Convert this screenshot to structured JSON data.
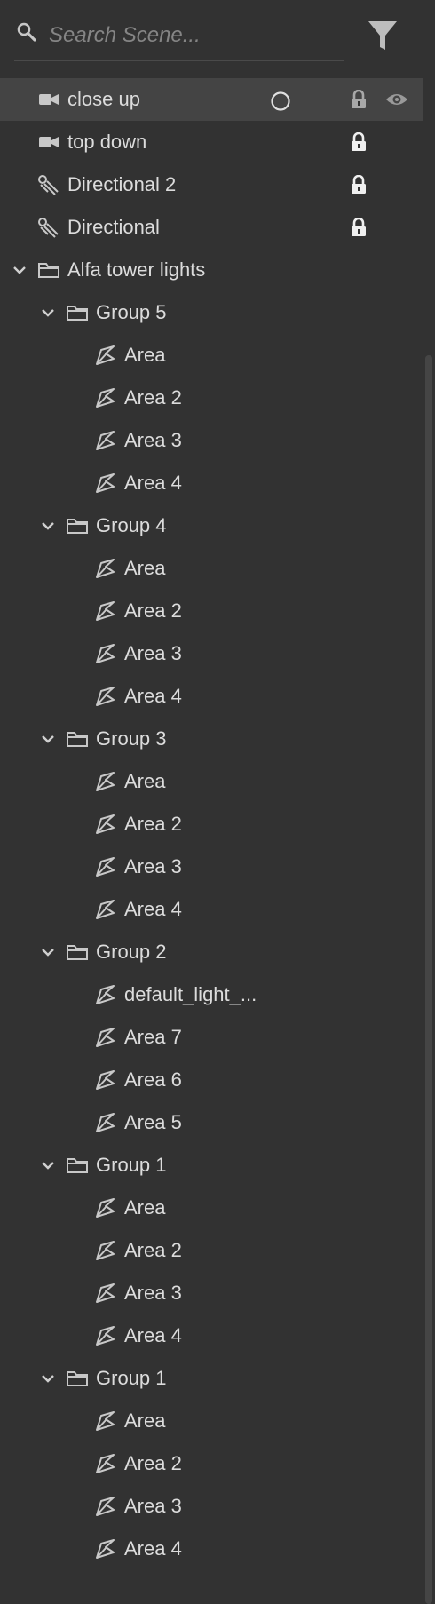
{
  "search": {
    "placeholder": "Search Scene..."
  },
  "icons": {
    "search": "search-icon",
    "filter": "filter-icon"
  },
  "colors": {
    "background": "#323232",
    "selected_row": "#444444",
    "text": "#dcdcdc"
  },
  "tree": {
    "items": [
      {
        "label": "close up",
        "type": "camera",
        "depth": 0,
        "selected": true,
        "locked": true,
        "visible": true,
        "circle": true
      },
      {
        "label": "top down",
        "type": "camera",
        "depth": 0,
        "locked": true
      },
      {
        "label": "Directional 2",
        "type": "directional",
        "depth": 0,
        "locked": true
      },
      {
        "label": "Directional",
        "type": "directional",
        "depth": 0,
        "locked": true
      },
      {
        "label": "Alfa tower lights",
        "type": "folder",
        "depth": 0,
        "expanded": true
      },
      {
        "label": "Group 5",
        "type": "folder",
        "depth": 1,
        "expanded": true
      },
      {
        "label": "Area",
        "type": "area",
        "depth": 2
      },
      {
        "label": "Area 2",
        "type": "area",
        "depth": 2
      },
      {
        "label": "Area 3",
        "type": "area",
        "depth": 2
      },
      {
        "label": "Area 4",
        "type": "area",
        "depth": 2
      },
      {
        "label": "Group 4",
        "type": "folder",
        "depth": 1,
        "expanded": true
      },
      {
        "label": "Area",
        "type": "area",
        "depth": 2
      },
      {
        "label": "Area 2",
        "type": "area",
        "depth": 2
      },
      {
        "label": "Area 3",
        "type": "area",
        "depth": 2
      },
      {
        "label": "Area 4",
        "type": "area",
        "depth": 2
      },
      {
        "label": "Group 3",
        "type": "folder",
        "depth": 1,
        "expanded": true
      },
      {
        "label": "Area",
        "type": "area",
        "depth": 2
      },
      {
        "label": "Area 2",
        "type": "area",
        "depth": 2
      },
      {
        "label": "Area 3",
        "type": "area",
        "depth": 2
      },
      {
        "label": "Area 4",
        "type": "area",
        "depth": 2
      },
      {
        "label": "Group 2",
        "type": "folder",
        "depth": 1,
        "expanded": true
      },
      {
        "label": "default_light_...",
        "type": "area",
        "depth": 2
      },
      {
        "label": "Area 7",
        "type": "area",
        "depth": 2
      },
      {
        "label": "Area 6",
        "type": "area",
        "depth": 2
      },
      {
        "label": "Area 5",
        "type": "area",
        "depth": 2
      },
      {
        "label": "Group 1",
        "type": "folder",
        "depth": 1,
        "expanded": true
      },
      {
        "label": "Area",
        "type": "area",
        "depth": 2
      },
      {
        "label": "Area 2",
        "type": "area",
        "depth": 2
      },
      {
        "label": "Area 3",
        "type": "area",
        "depth": 2
      },
      {
        "label": "Area 4",
        "type": "area",
        "depth": 2
      },
      {
        "label": "Group 1",
        "type": "folder",
        "depth": 1,
        "expanded": true
      },
      {
        "label": "Area",
        "type": "area",
        "depth": 2
      },
      {
        "label": "Area 2",
        "type": "area",
        "depth": 2
      },
      {
        "label": "Area 3",
        "type": "area",
        "depth": 2
      },
      {
        "label": "Area 4",
        "type": "area",
        "depth": 2
      }
    ]
  }
}
